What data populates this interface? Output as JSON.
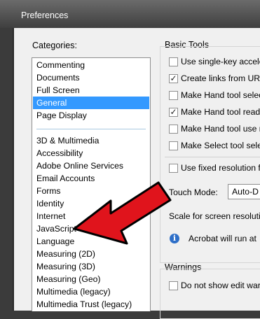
{
  "window": {
    "title": "Preferences"
  },
  "categories": {
    "label": "Categories:",
    "top_items": [
      "Commenting",
      "Documents",
      "Full Screen",
      "General",
      "Page Display"
    ],
    "selected": "General",
    "other_items": [
      "3D & Multimedia",
      "Accessibility",
      "Adobe Online Services",
      "Email Accounts",
      "Forms",
      "Identity",
      "Internet",
      "JavaScript",
      "Language",
      "Measuring (2D)",
      "Measuring (3D)",
      "Measuring (Geo)",
      "Multimedia (legacy)",
      "Multimedia Trust (legacy)"
    ]
  },
  "basic_tools": {
    "label": "Basic Tools",
    "options": [
      {
        "label": "Use single-key accele",
        "checked": false
      },
      {
        "label": "Create links from URL",
        "checked": true
      },
      {
        "label": "Make Hand tool selec",
        "checked": false
      },
      {
        "label": "Make Hand tool read",
        "checked": true
      },
      {
        "label": "Make Hand tool use r",
        "checked": false
      },
      {
        "label": "Make Select tool sele",
        "checked": false
      }
    ],
    "fixed_resolution": {
      "label": "Use fixed resolution fo",
      "checked": false
    },
    "touch_mode": {
      "label": "Touch Mode:",
      "value": "Auto-D"
    },
    "scale_label": "Scale for screen resolutio",
    "info_text": "Acrobat will run at"
  },
  "warnings": {
    "label": "Warnings",
    "option": {
      "label": "Do not show edit warn",
      "checked": false
    }
  },
  "colors": {
    "selection": "#3399ff",
    "arrow": "#e0141c",
    "info": "#2e6fc8"
  },
  "icons": {
    "info": "info-icon",
    "arrow": "red-arrow-annotation"
  }
}
